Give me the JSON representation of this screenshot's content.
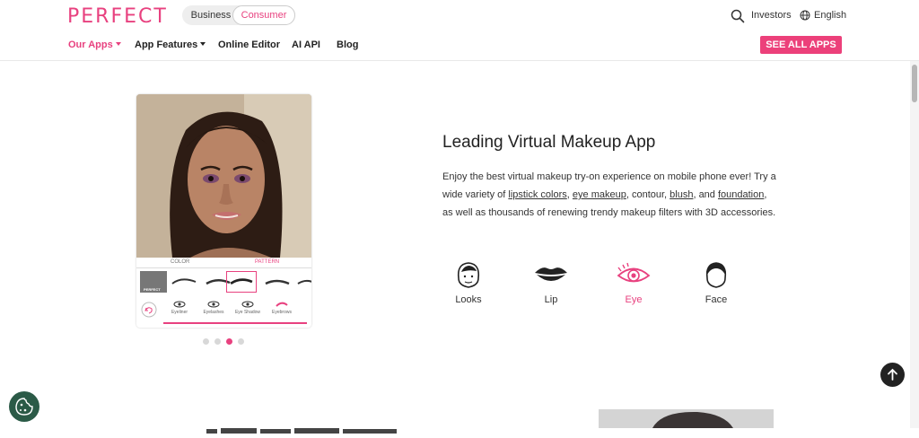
{
  "header": {
    "logo": "PERFECT",
    "segment": {
      "business": "Business",
      "consumer": "Consumer"
    },
    "investors": "Investors",
    "language": "English",
    "nav": [
      {
        "label": "Our Apps"
      },
      {
        "label": "App Features"
      },
      {
        "label": "Online Editor"
      },
      {
        "label": "AI API"
      },
      {
        "label": "Blog"
      }
    ],
    "cta": "SEE ALL APPS"
  },
  "hero": {
    "title": "Leading Virtual Makeup App",
    "paragraph": {
      "p1": "Enjoy the best virtual makeup try-on experience on mobile phone ever! Try a wide variety of ",
      "link1": "lipstick colors",
      "p2": ", ",
      "link2": "eye makeup",
      "p3": ", contour, ",
      "link3": "blush",
      "p4": ", and ",
      "link4": "foundation",
      "p5": ", as well as thousands of renewing trendy makeup filters with 3D accessories."
    },
    "features": [
      {
        "label": "Looks",
        "icon": "looks-face-icon"
      },
      {
        "label": "Lip",
        "icon": "lip-icon"
      },
      {
        "label": "Eye",
        "icon": "eye-icon"
      },
      {
        "label": "Face",
        "icon": "face-icon"
      }
    ],
    "active_feature": "Eye"
  },
  "phone_ui": {
    "tabs": {
      "color": "COLOR",
      "pattern": "PATTERN"
    },
    "tools": [
      "Eyeliner",
      "Eyelashes",
      "Eye Shadow",
      "Eyebrows"
    ],
    "thumb_label": "PERFECT"
  },
  "carousel": {
    "count": 4,
    "active_index": 2
  },
  "colors": {
    "brand": "#e8417f",
    "cta": "#ec407a",
    "text": "#222222"
  }
}
